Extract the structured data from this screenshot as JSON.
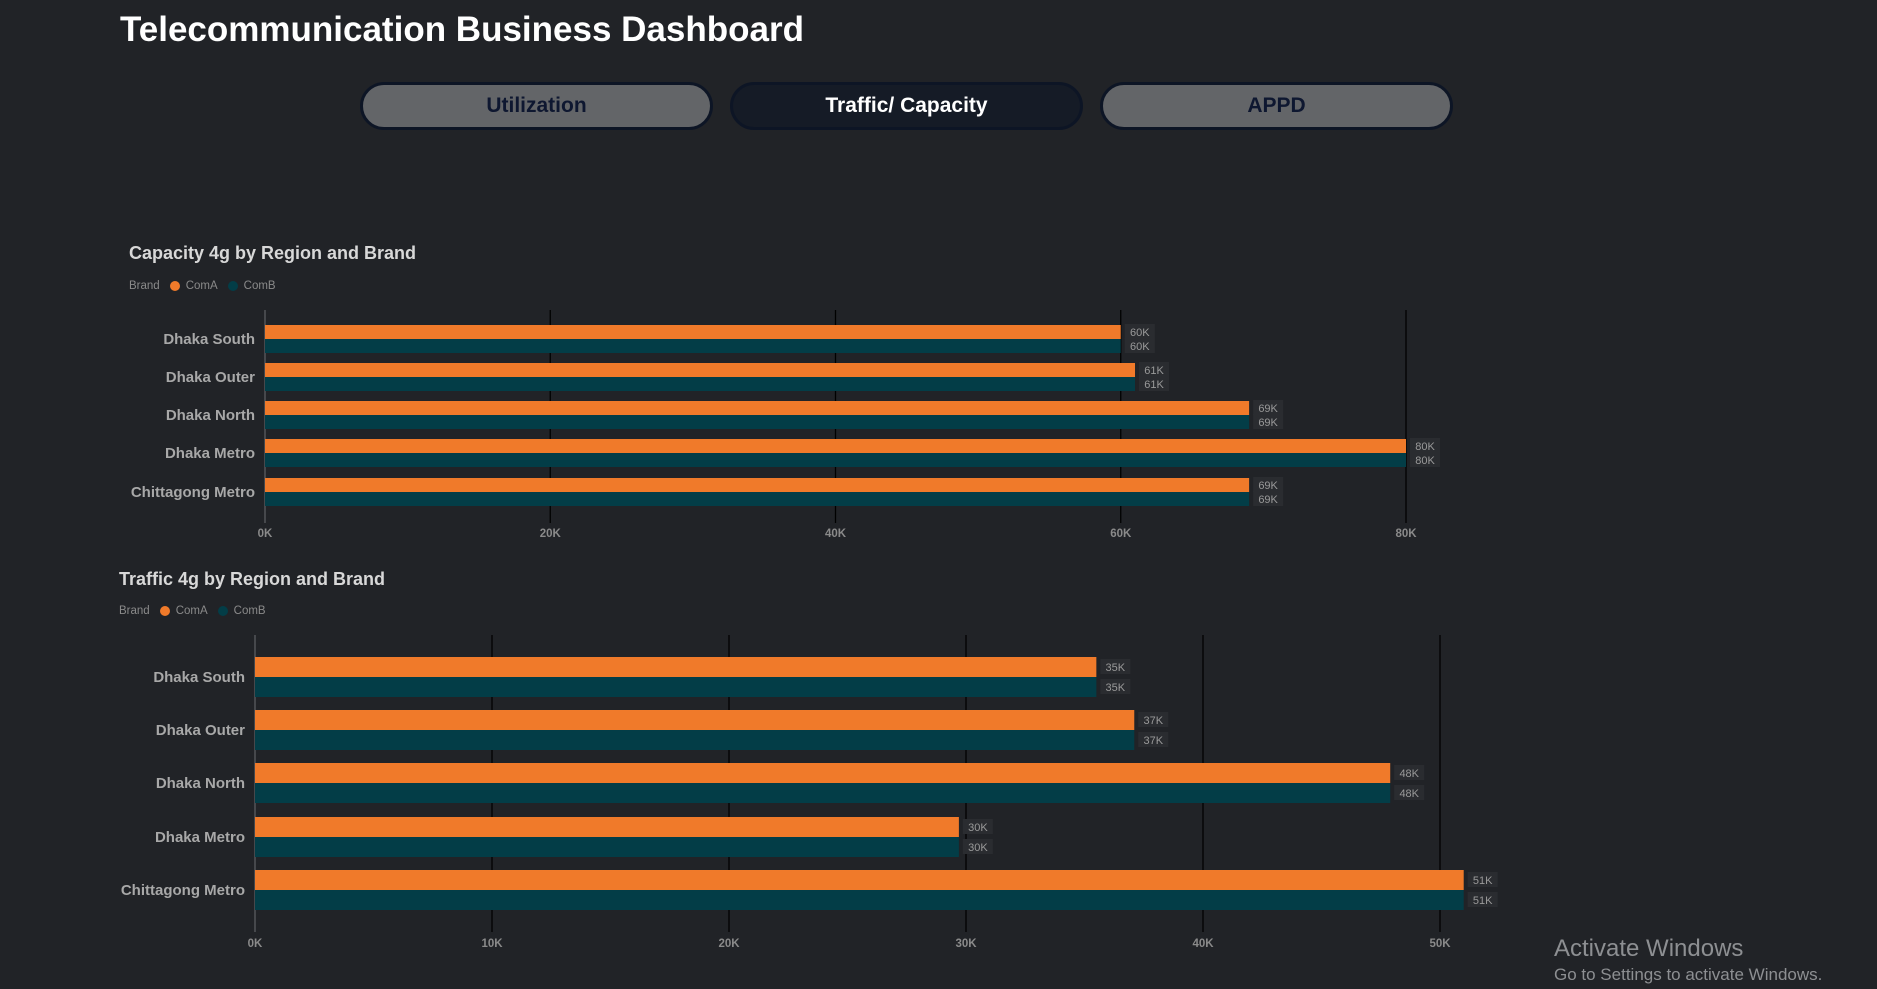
{
  "title": "Telecommunication Business Dashboard",
  "tabs": [
    {
      "label": "Utilization",
      "active": false
    },
    {
      "label": "Traffic/ Capacity",
      "active": true
    },
    {
      "label": "APPD",
      "active": false
    }
  ],
  "colors": {
    "ComA": "#f07a2a",
    "ComB": "#033d47",
    "background": "#212327"
  },
  "legend": {
    "title": "Brand",
    "items": [
      "ComA",
      "ComB"
    ]
  },
  "chart_data": [
    {
      "type": "bar",
      "orientation": "horizontal",
      "title": "Capacity 4g by Region and Brand",
      "categories": [
        "Dhaka South",
        "Dhaka Outer",
        "Dhaka North",
        "Dhaka Metro",
        "Chittagong Metro"
      ],
      "series": [
        {
          "name": "ComA",
          "values": [
            60000,
            61000,
            69000,
            80000,
            69000
          ],
          "labels": [
            "60K",
            "61K",
            "69K",
            "80K",
            "69K"
          ]
        },
        {
          "name": "ComB",
          "values": [
            60000,
            61000,
            69000,
            80000,
            69000
          ],
          "labels": [
            "60K",
            "61K",
            "69K",
            "80K",
            "69K"
          ]
        }
      ],
      "xlim": [
        0,
        80000
      ],
      "xticks": [
        0,
        20000,
        40000,
        60000,
        80000
      ],
      "xtick_labels": [
        "0K",
        "20K",
        "40K",
        "60K",
        "80K"
      ],
      "grid": "vertical",
      "legend_position": "top-left"
    },
    {
      "type": "bar",
      "orientation": "horizontal",
      "title": "Traffic 4g by Region and Brand",
      "categories": [
        "Dhaka South",
        "Dhaka Outer",
        "Dhaka North",
        "Dhaka Metro",
        "Chittagong Metro"
      ],
      "series": [
        {
          "name": "ComA",
          "values": [
            35500,
            37100,
            47900,
            29700,
            51000
          ],
          "labels": [
            "35K",
            "37K",
            "48K",
            "30K",
            "51K"
          ]
        },
        {
          "name": "ComB",
          "values": [
            35500,
            37100,
            47900,
            29700,
            51000
          ],
          "labels": [
            "35K",
            "37K",
            "48K",
            "30K",
            "51K"
          ]
        }
      ],
      "xlim": [
        0,
        50000
      ],
      "xticks": [
        0,
        10000,
        20000,
        30000,
        40000,
        50000
      ],
      "xtick_labels": [
        "0K",
        "10K",
        "20K",
        "30K",
        "40K",
        "50K"
      ],
      "grid": "vertical",
      "legend_position": "top-left"
    }
  ],
  "watermark": {
    "line1": "Activate Windows",
    "line2": "Go to Settings to activate Windows."
  }
}
